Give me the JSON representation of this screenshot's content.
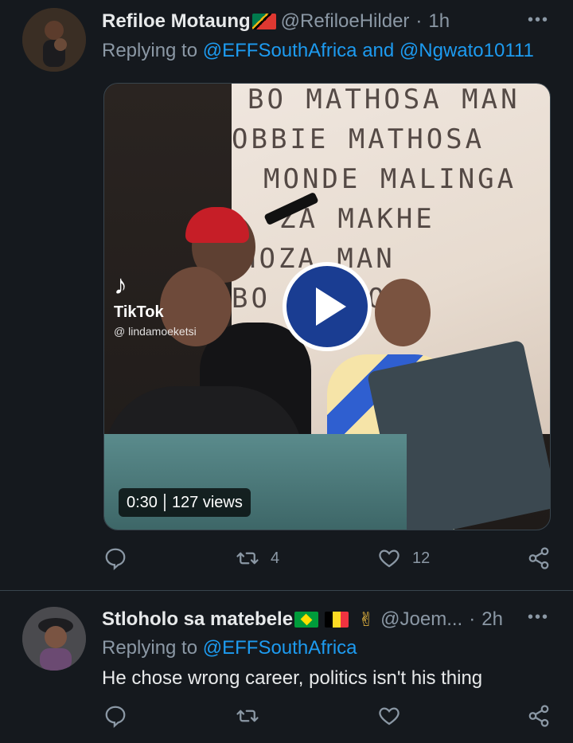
{
  "tweets": [
    {
      "display_name": "Refiloe Motaung",
      "handle": "@RefiloeHilder",
      "time": "1h",
      "replying_label": "Replying to",
      "mentions": [
        "@EFFSouthAfrica",
        "and",
        "@Ngwato10111"
      ],
      "media": {
        "watermark_brand": "TikTok",
        "watermark_user": "@ lindamoeketsi",
        "duration": "0:30",
        "views": "127 views"
      },
      "stats": {
        "retweets": "4",
        "likes": "12"
      }
    },
    {
      "display_name": "Stloholo sa matebele",
      "handle": "@Joem...",
      "time": "2h",
      "replying_label": "Replying to",
      "mentions": [
        "@EFFSouthAfrica"
      ],
      "body": "He chose wrong career, politics isn't his thing",
      "emoji": "✌"
    }
  ],
  "common": {
    "separator_dot": "·",
    "more_icon": "•••"
  },
  "icons": {
    "reply": "reply-icon",
    "retweet": "retweet-icon",
    "like": "heart-icon",
    "share": "share-icon",
    "play": "play-icon",
    "more": "more-icon"
  },
  "colors": {
    "background": "#15191e",
    "text_primary": "#e7e9ea",
    "text_secondary": "#8b98a5",
    "link": "#1d9bf0",
    "divider": "#38444d"
  }
}
